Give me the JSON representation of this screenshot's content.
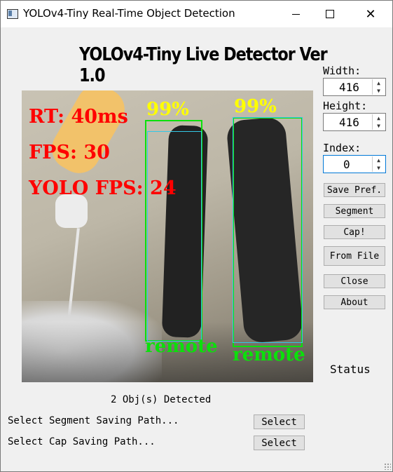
{
  "window": {
    "title": "YOLOv4-Tiny Real-Time Object Detection",
    "close_glyph": "✕"
  },
  "heading": "YOLOv4-Tiny Live Detector Ver 1.0",
  "video": {
    "overlay": {
      "rt": "RT: 40ms",
      "fps": "FPS: 30",
      "yolo_fps": "YOLO FPS: 24"
    },
    "detections": [
      {
        "label": "remote",
        "confidence": "99%"
      },
      {
        "label": "remote",
        "confidence": "99%"
      }
    ]
  },
  "settings": {
    "width_label": "Width:",
    "width_value": "416",
    "height_label": "Height:",
    "height_value": "416",
    "index_label": "Index:",
    "index_value": "0"
  },
  "buttons": {
    "save_pref": "Save Pref.",
    "segment": "Segment",
    "cap": "Cap!",
    "from_file": "From File",
    "close": "Close",
    "about": "About"
  },
  "status": "Status",
  "detected_text": "2 Obj(s) Detected",
  "paths": {
    "segment_label": "Select Segment Saving Path...",
    "cap_label": "Select Cap Saving Path...",
    "select_button": "Select"
  }
}
